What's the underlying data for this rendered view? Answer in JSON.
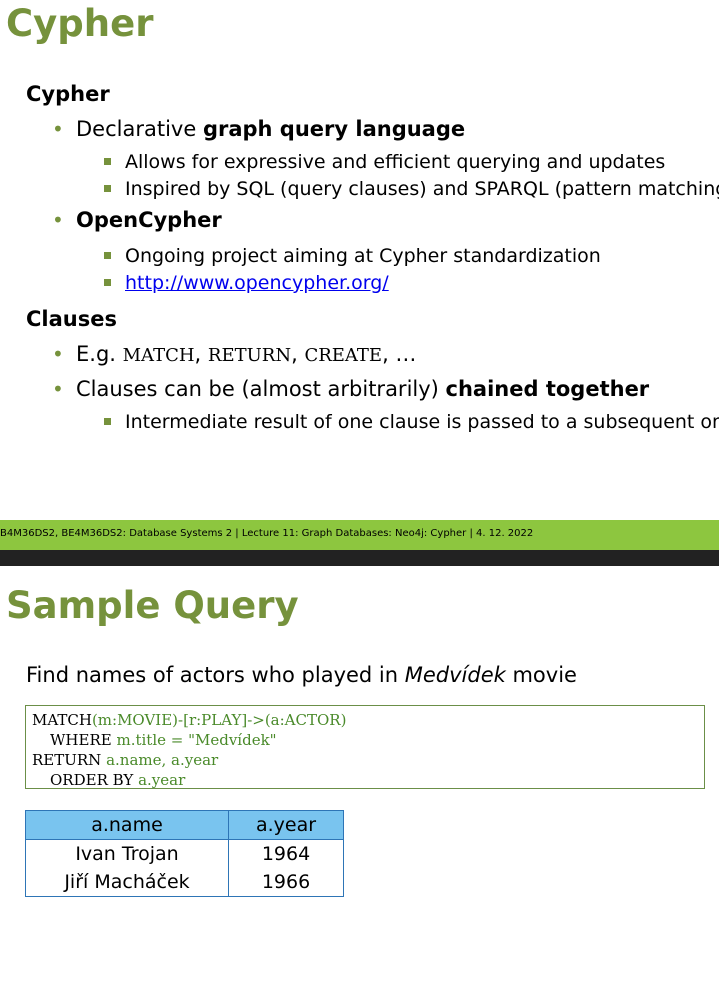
{
  "slide1": {
    "title": "Cypher",
    "section1": "Cypher",
    "b1_prefix": "Declarative ",
    "b1_bold": "graph query language",
    "b1_sub1": "Allows for expressive and efficient querying and updates",
    "b1_sub2": "Inspired by SQL (query clauses) and SPARQL (pattern matching)",
    "b2_bold": "OpenCypher",
    "b2_sub1": "Ongoing project aiming at Cypher standardization",
    "b2_sub2_link": "http://www.opencypher.org/",
    "section2": "Clauses",
    "c1_prefix": "E.g. ",
    "c1_code1": "MATCH",
    "c1_sep1": ", ",
    "c1_code2": "RETURN",
    "c1_sep2": ", ",
    "c1_code3": "CREATE",
    "c1_suffix": ", …",
    "c2_prefix": "Clauses can be (almost arbitrarily) ",
    "c2_bold": "chained together",
    "c2_sub1": "Intermediate result of one clause is passed to a subsequent one"
  },
  "footer": {
    "text": "B4M36DS2, BE4M36DS2: Database Systems 2  |  Lecture 11: Graph Databases: Neo4j: Cypher | 4. 12. 2022"
  },
  "slide2": {
    "title": "Sample Query",
    "intro_prefix": "Find names of actors who played in ",
    "intro_italic": "Medvídek",
    "intro_suffix": " movie",
    "query": {
      "l1_kw": "MATCH",
      "l1_tx": "(m:MOVIE)-[r:PLAY]->(a:ACTOR)",
      "l2_kw": "WHERE",
      "l2_tx": " m.title = \"Medvídek\"",
      "l3_kw": "RETURN",
      "l3_tx": " a.name, a.year",
      "l4_kw": "ORDER BY",
      "l4_tx": " a.year"
    },
    "table": {
      "headers": [
        "a.name",
        "a.year"
      ],
      "rows": [
        [
          "Ivan Trojan",
          "1964"
        ],
        [
          "Jiří Macháček",
          "1966"
        ]
      ]
    }
  },
  "colors": {
    "accent": "#76923c",
    "footer_band": "#8dc63f",
    "table_header": "#79c4ef"
  }
}
